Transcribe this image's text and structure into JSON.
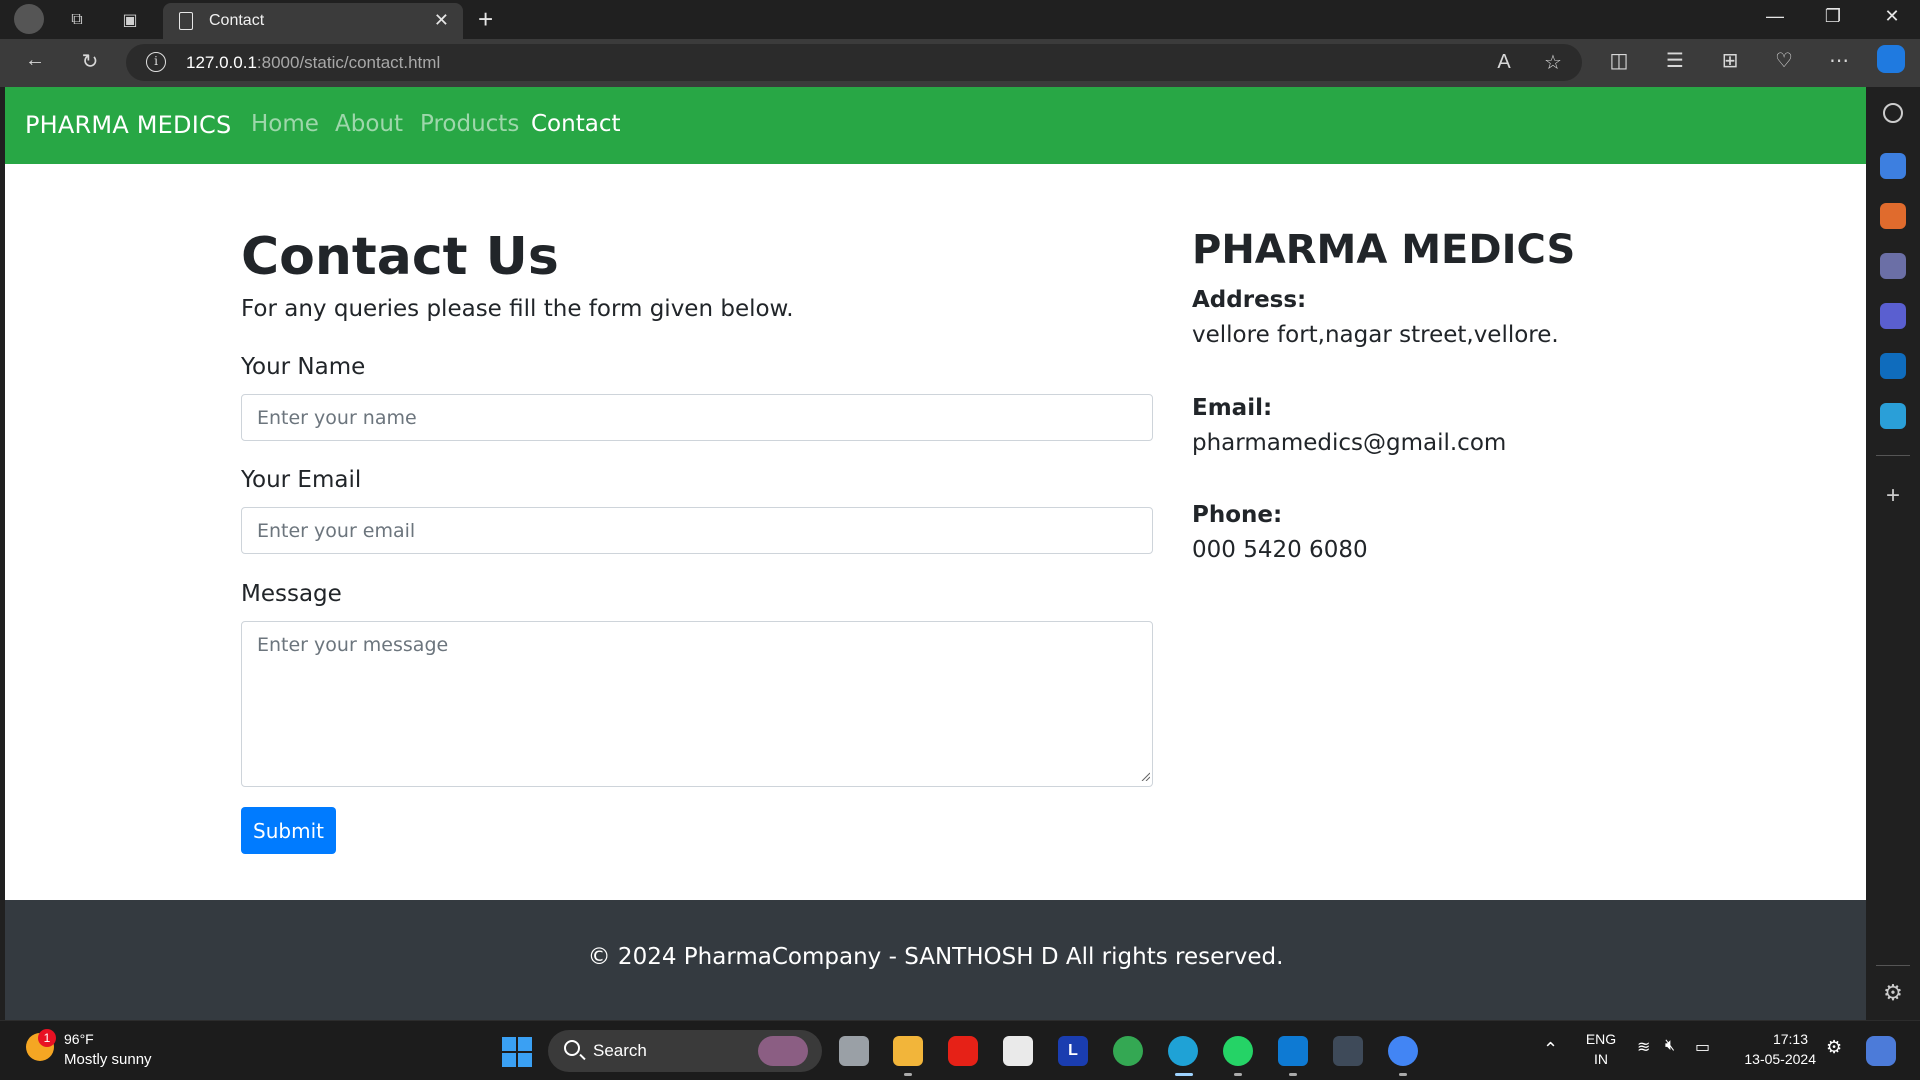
{
  "browser": {
    "tab_title": "Contact",
    "url_host": "127.0.0.1",
    "url_rest": ":8000/static/contact.html"
  },
  "site": {
    "brand": "PHARMA MEDICS",
    "nav": [
      "Home",
      "About",
      "Products",
      "Contact"
    ],
    "active_nav": "Contact",
    "nav_color": "#28a745"
  },
  "form": {
    "heading": "Contact Us",
    "lead": "For any queries please fill the form given below.",
    "name_label": "Your Name",
    "name_placeholder": "Enter your name",
    "email_label": "Your Email",
    "email_placeholder": "Enter your email",
    "message_label": "Message",
    "message_placeholder": "Enter your message",
    "submit_label": "Submit",
    "submit_color": "#007bff"
  },
  "contact_info": {
    "title": "PHARMA MEDICS",
    "address_label": "Address:",
    "address": "vellore fort,nagar street,vellore.",
    "email_label": "Email:",
    "email": "pharmamedics@gmail.com",
    "phone_label": "Phone:",
    "phone": "000 5420 6080"
  },
  "footer": {
    "text": "© 2024 PharmaCompany - SANTHOSH D All rights reserved."
  },
  "taskbar": {
    "weather_badge": "1",
    "weather_temp": "96°F",
    "weather_desc": "Mostly sunny",
    "search_label": "Search",
    "lang_top": "ENG",
    "lang_bottom": "IN",
    "time": "17:13",
    "date": "13-05-2024"
  }
}
